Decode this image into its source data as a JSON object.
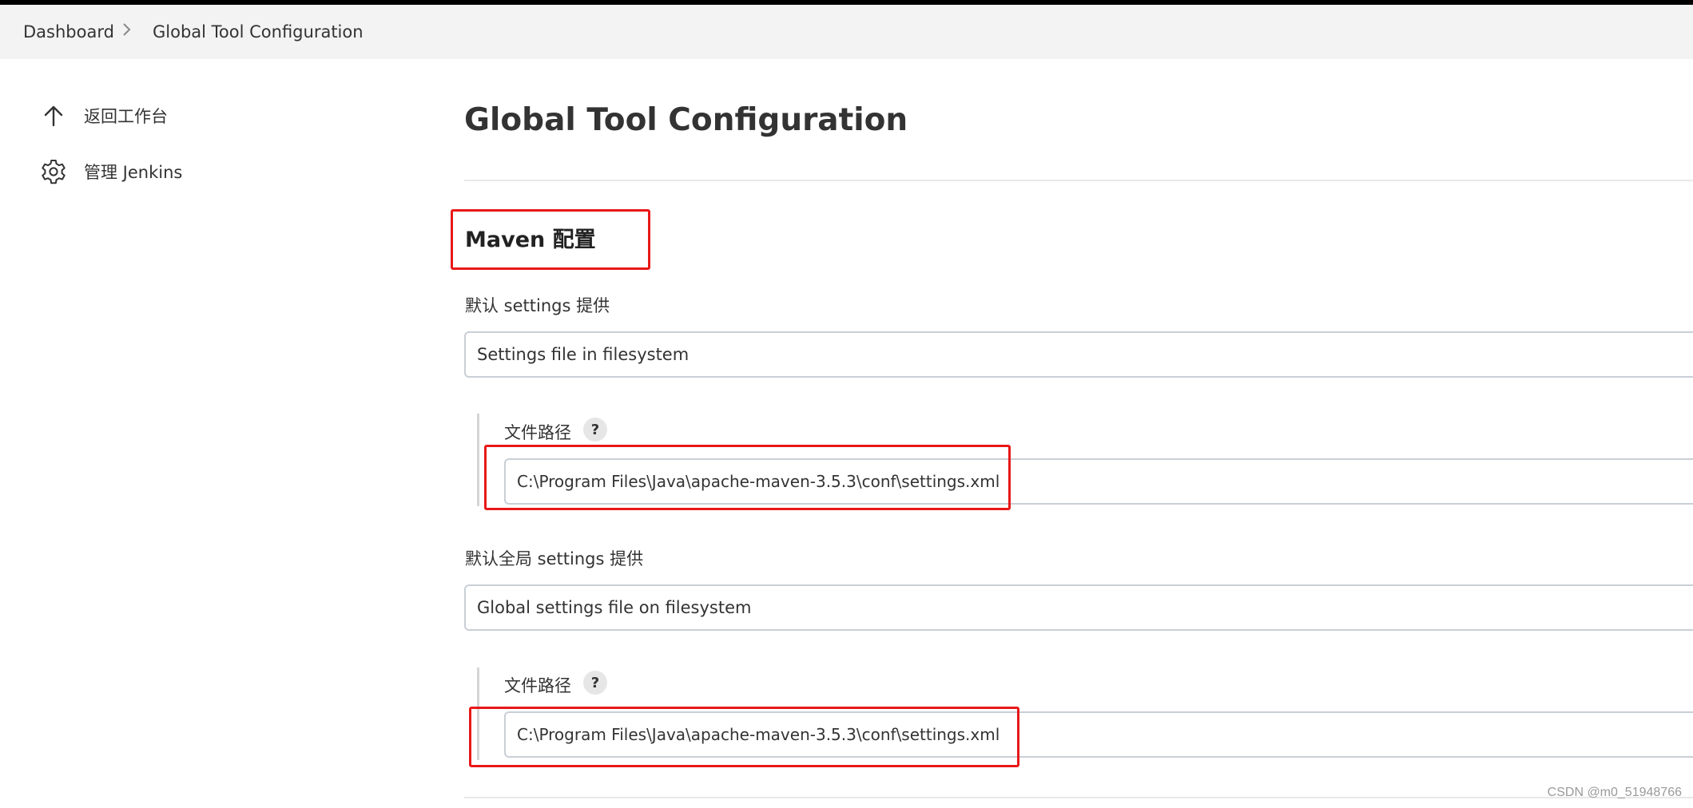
{
  "breadcrumb": {
    "items": [
      {
        "label": "Dashboard"
      },
      {
        "label": "Global Tool Configuration"
      }
    ],
    "separator": ">"
  },
  "sidebar": {
    "items": [
      {
        "label": "返回工作台",
        "icon": "arrow-up-icon"
      },
      {
        "label": "管理 Jenkins",
        "icon": "gear-icon"
      }
    ]
  },
  "main": {
    "title": "Global Tool Configuration",
    "section_title": "Maven 配置",
    "default_settings": {
      "label": "默认 settings 提供",
      "selected": "Settings file in filesystem",
      "path_label": "文件路径",
      "help": "?",
      "path_value": "C:\\Program Files\\Java\\apache-maven-3.5.3\\conf\\settings.xml"
    },
    "global_settings": {
      "label": "默认全局 settings 提供",
      "selected": "Global settings file on filesystem",
      "path_label": "文件路径",
      "help": "?",
      "path_value": "C:\\Program Files\\Java\\apache-maven-3.5.3\\conf\\settings.xml"
    }
  },
  "watermark": "CSDN @m0_51948766",
  "colors": {
    "highlight": "#e81818",
    "breadcrumb_bg": "#f3f3f3",
    "input_border": "#c9cfd6"
  }
}
